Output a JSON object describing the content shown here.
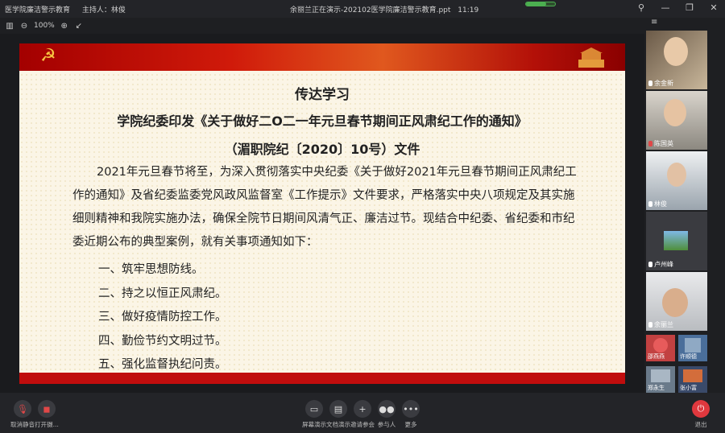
{
  "titlebar": {
    "meeting_name": "医学院廉洁警示教育",
    "host_label": "主持人：林俊",
    "presenting": "余丽兰正在演示-202102医学院廉洁警示教育.ppt",
    "time": "11:19",
    "icons": [
      "pin-icon",
      "minimize-icon",
      "restore-icon",
      "close-icon"
    ]
  },
  "viewer": {
    "zoom": "100%"
  },
  "slide": {
    "title": "传达学习",
    "subtitle": "学院纪委印发《关于做好二O二一年元旦春节期间正风肃纪工作的通知》",
    "doc_no": "（湄职院纪〔2020〕10号）文件",
    "body": "2021年元旦春节将至，为深入贯彻落实中央纪委《关于做好2021年元旦春节期间正风肃纪工作的通知》及省纪委监委党风政风监督室《工作提示》文件要求，严格落实中央八项规定及其实施细则精神和我院实施办法，确保全院节日期间风清气正、廉洁过节。现结合中纪委、省纪委和市纪委近期公布的典型案例，就有关事项通知如下：",
    "items": [
      "一、筑牢思想防线。",
      "二、持之以恒正风肃纪。",
      "三、做好疫情防控工作。",
      "四、勤俭节约文明过节。",
      "五、强化监督执纪问责。"
    ]
  },
  "participants": [
    {
      "name": "余金新"
    },
    {
      "name": "陈国英"
    },
    {
      "name": "林俊"
    },
    {
      "name": "卢州峰"
    },
    {
      "name": "余丽兰"
    }
  ],
  "small_participants": [
    {
      "name": "邵燕燕"
    },
    {
      "name": "许顺德"
    },
    {
      "name": "郑永生"
    },
    {
      "name": "张小富"
    }
  ],
  "toolbar": {
    "mute": "取消静音",
    "video": "打开摄...",
    "share": "屏幕演示",
    "doc": "文档演示",
    "invite": "邀请参会",
    "members": "参与人",
    "more": "更多",
    "leave": "退出"
  }
}
